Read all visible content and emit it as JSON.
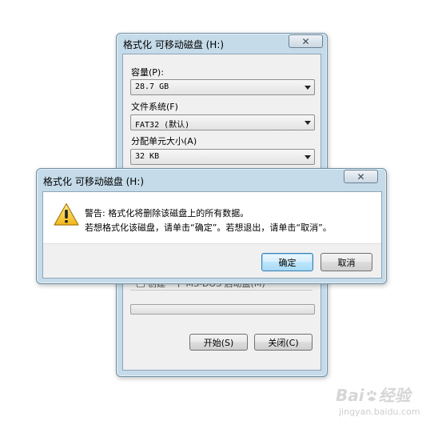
{
  "format_dialog": {
    "title": "格式化 可移动磁盘 (H:)",
    "close_glyph": "✕",
    "capacity": {
      "label": "容量(P):",
      "value": "28.7 GB"
    },
    "filesystem": {
      "label": "文件系统(F)",
      "value": "FAT32 (默认)"
    },
    "allocation": {
      "label": "分配单元大小(A)",
      "value": "32 KB"
    },
    "partial_checkbox_text": "创建一个 MS-DOS 启动盘(M)",
    "progress": 0,
    "start_button": "开始(S)",
    "close_button": "关闭(C)"
  },
  "warning_dialog": {
    "title": "格式化 可移动磁盘 (H:)",
    "close_glyph": "✕",
    "icon": "warning-icon",
    "line1": "警告: 格式化将删除该磁盘上的所有数据。",
    "line2": "若想格式化该磁盘，请单击“确定”。若想退出，请单击“取消”。",
    "ok_button": "确定",
    "cancel_button": "取消"
  },
  "watermark": {
    "brand_left": "Bai",
    "brand_right": "经验",
    "url": "jingyan.baidu.com"
  }
}
